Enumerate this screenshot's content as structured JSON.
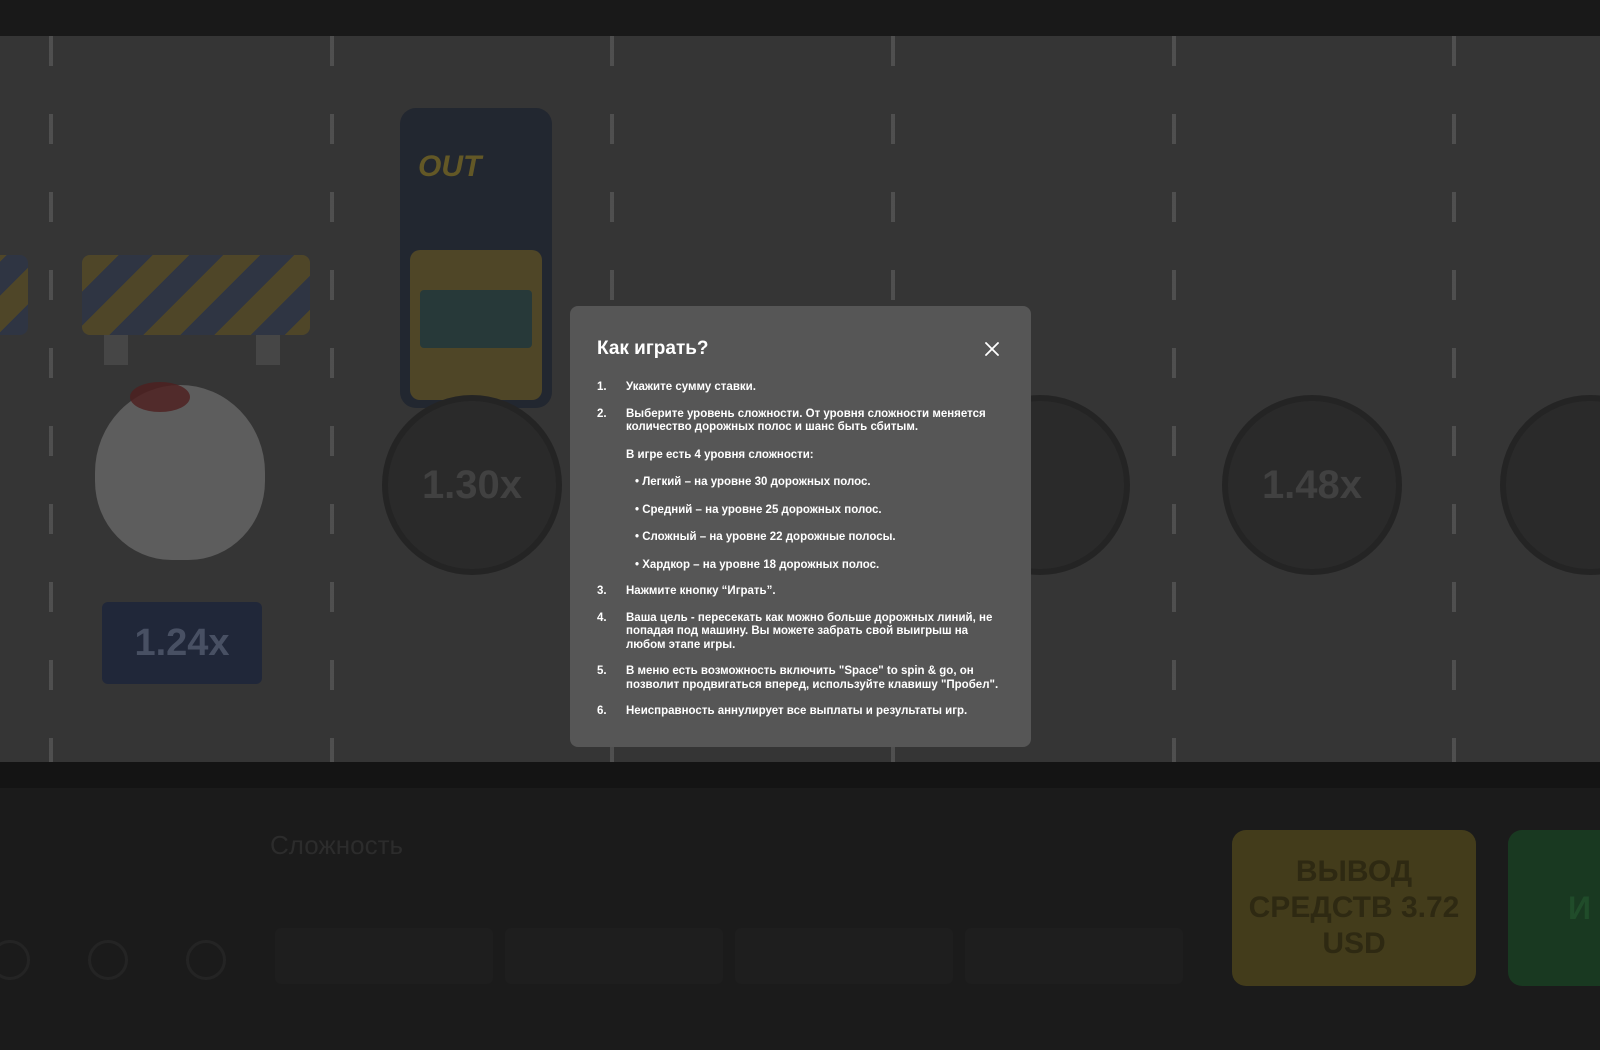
{
  "modal": {
    "title": "Как играть?",
    "close_icon": "close-icon",
    "steps": [
      {
        "num": "1.",
        "text": "Укажите сумму ставки."
      },
      {
        "num": "2.",
        "text": "Выберите уровень сложности. От уровня сложности меняется количество дорожных полос и шанс быть сбитым.",
        "subnote": "В игре есть 4 уровня сложности:",
        "levels": [
          "• Легкий – на уровне 30 дорожных полос.",
          "• Средний – на уровне 25 дорожных полос.",
          "• Сложный – на уровне 22 дорожные полосы.",
          "• Хардкор – на уровне 18 дорожных полос."
        ]
      },
      {
        "num": "3.",
        "text": "Нажмите кнопку “Играть”."
      },
      {
        "num": "4.",
        "text": "Ваша цель - пересекать как можно больше дорожных линий, не попадая под машину. Вы можете забрать свой выигрыш на любом этапе игры."
      },
      {
        "num": "5.",
        "text": "В меню есть возможность включить \"Space\" to spin & go, он позволит продвигаться вперед, используйте клавишу \"Пробел\"."
      },
      {
        "num": "6.",
        "text": "Неисправность аннулирует все выплаты и результаты игр."
      }
    ]
  },
  "background": {
    "multipliers": [
      "1.30x",
      "1.48x",
      "1.24x"
    ],
    "truck_logo": "OUT",
    "difficulty_label": "Сложность",
    "cashout_label": "ВЫВОД СРЕДСТВ 3.72 USD",
    "play_label": "И"
  },
  "colors": {
    "modal_bg": "#565656",
    "overlay": "#1f1f1f",
    "cashout": "#5d5426",
    "play": "#23502e"
  }
}
